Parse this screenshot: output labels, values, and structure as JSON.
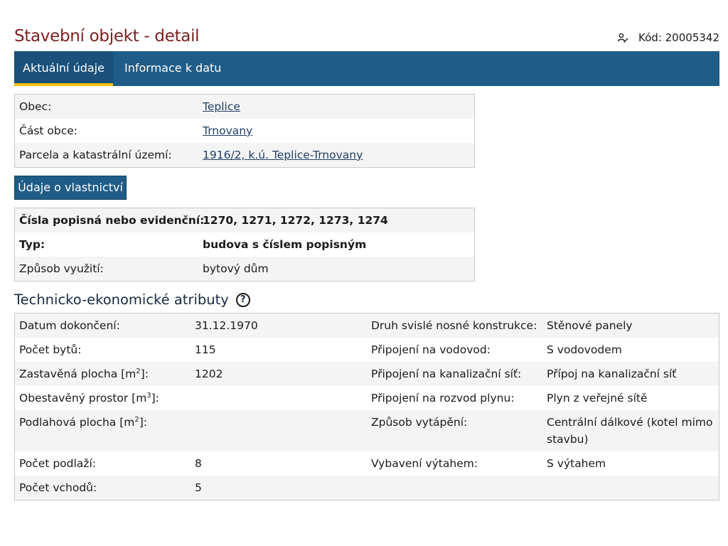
{
  "header": {
    "title": "Stavební objekt - detail",
    "code_label": "Kód: 20005342"
  },
  "tabs": [
    {
      "label": "Aktuální údaje",
      "active": true
    },
    {
      "label": "Informace k datu",
      "active": false
    }
  ],
  "location": {
    "rows": [
      {
        "label": "Obec:",
        "value": "Teplice"
      },
      {
        "label": "Část obce:",
        "value": "Trnovany"
      },
      {
        "label": "Parcela a katastrální území:",
        "value": "1916/2, k.ú. Teplice-Trnovany"
      }
    ]
  },
  "ownership_button": "Údaje o vlastnictví",
  "building": {
    "rows": [
      {
        "label": "Čísla popisná nebo evidenční:",
        "value": "1270, 1271, 1272, 1273, 1274"
      },
      {
        "label": "Typ:",
        "value": "budova s číslem popisným"
      },
      {
        "label": "Způsob využití:",
        "value": "bytový dům"
      }
    ]
  },
  "tech": {
    "title": "Technicko-ekonomické atributy",
    "help_icon": "question-circle-icon",
    "rows": [
      {
        "l1": "Datum dokončení:",
        "v1": "31.12.1970",
        "l2": "Druh svislé nosné konstrukce:",
        "v2": "Stěnové panely"
      },
      {
        "l1": "Počet bytů:",
        "v1": "115",
        "l2": "Připojení na vodovod:",
        "v2": "S vodovodem"
      },
      {
        "l1_pre": "Zastavěná plocha [m",
        "l1_sup": "2",
        "l1_post": "]:",
        "v1": "1202",
        "l2": "Připojení na kanalizační síť:",
        "v2": "Přípoj na kanalizační síť"
      },
      {
        "l1_pre": "Obestavěný prostor [m",
        "l1_sup": "3",
        "l1_post": "]:",
        "v1": "",
        "l2": "Připojení na rozvod plynu:",
        "v2": "Plyn z veřejné sítě"
      },
      {
        "l1_pre": "Podlahová plocha [m",
        "l1_sup": "2",
        "l1_post": "]:",
        "v1": "",
        "l2": "Způsob vytápění:",
        "v2": "Centrální dálkové (kotel mimo stavbu)"
      },
      {
        "l1": "Počet podlaží:",
        "v1": "8",
        "l2": "Vybavení výtahem:",
        "v2": "S výtahem"
      },
      {
        "l1": "Počet vchodů:",
        "v1": "5",
        "l2": "",
        "v2": ""
      }
    ]
  },
  "colors": {
    "title": "#7a1f1f",
    "tabbar": "#1f5c87",
    "tab_indicator": "#f2c013",
    "link": "#1f3f66"
  }
}
